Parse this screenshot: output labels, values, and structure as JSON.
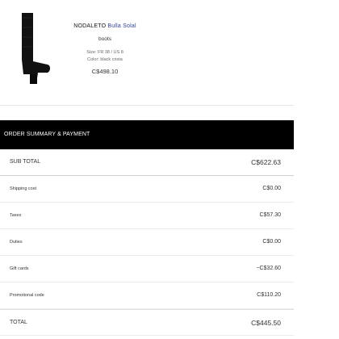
{
  "product": {
    "brand": "NODALETO",
    "model": "Bulla Solal",
    "type": "boots",
    "size": "Size: FR 38 / US 8",
    "color": "Color: black crista",
    "price": "C$498.10"
  },
  "summary": {
    "title": "ORDER SUMMARY & PAYMENT",
    "rows": [
      {
        "label": "SUB TOTAL",
        "value": "C$622.63"
      },
      {
        "label": "Shipping cost",
        "value": "C$0.00"
      },
      {
        "label": "Taxes",
        "value": "C$57.30"
      },
      {
        "label": "Duties",
        "value": "C$0.00"
      },
      {
        "label": "Gift cards",
        "value": "−C$32.60"
      },
      {
        "label": "Promotional code",
        "value": "C$110.20"
      },
      {
        "label": "TOTAL",
        "value": "C$445.50"
      }
    ]
  },
  "colors": {
    "header_bg": "#000000",
    "model_accent": "#2d3f8f"
  },
  "icons": {
    "product_image": "black-knee-high-boot"
  }
}
